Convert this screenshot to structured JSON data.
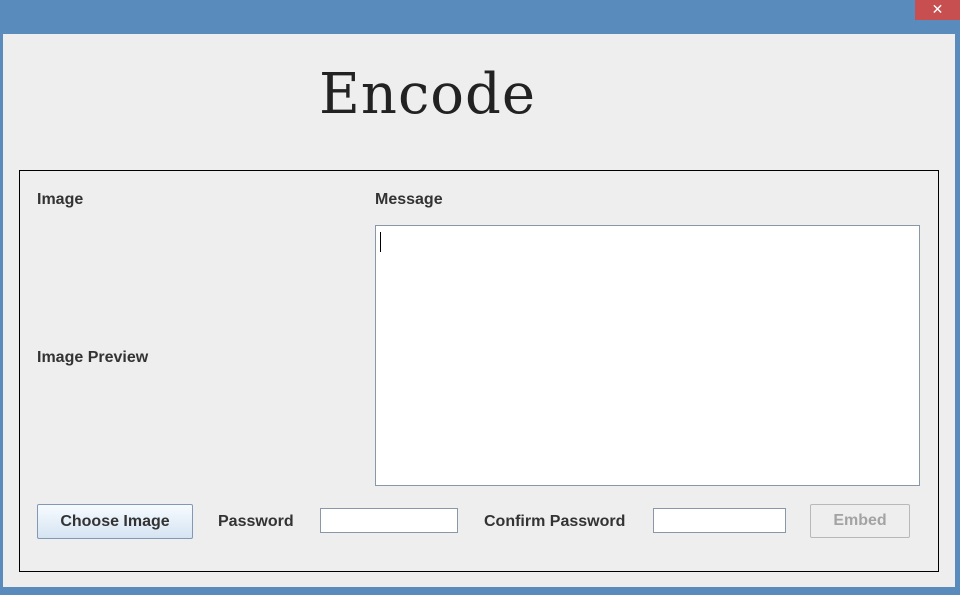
{
  "window": {
    "close_glyph": "✕"
  },
  "header": {
    "title": "Encode"
  },
  "form": {
    "image_label": "Image",
    "image_preview_label": "Image Preview",
    "message_label": "Message",
    "message_value": "",
    "choose_image_label": "Choose Image",
    "password_label": "Password",
    "password_value": "",
    "confirm_password_label": "Confirm Password",
    "confirm_password_value": "",
    "embed_label": "Embed",
    "embed_enabled": false
  },
  "colors": {
    "titlebar": "#5a8bbd",
    "close_button": "#c74f4f",
    "client_background": "#eeeeee",
    "disabled_text": "#a3a3a3"
  }
}
